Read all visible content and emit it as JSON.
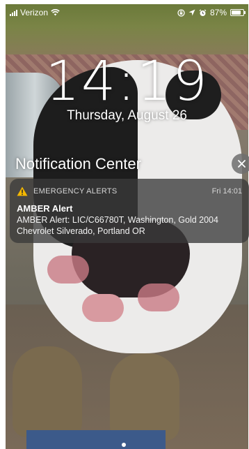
{
  "status_bar": {
    "carrier": "Verizon",
    "battery_percent": "87%"
  },
  "lock_screen": {
    "time": "14:19",
    "date": "Thursday, August 26"
  },
  "notification_center": {
    "title": "Notification Center"
  },
  "notification": {
    "app_name": "EMERGENCY ALERTS",
    "timestamp": "Fri 14:01",
    "title": "AMBER Alert",
    "body": "AMBER Alert: LIC/C66780T, Washington, Gold 2004 Chevrolet Silverado, Portland OR"
  },
  "colors": {
    "warning_icon": "#f5b800",
    "card_bg": "#3a3a3a"
  },
  "icons": [
    "signal-bars-icon",
    "wifi-icon",
    "orientation-lock-icon",
    "location-icon",
    "alarm-icon",
    "battery-icon",
    "warning-icon",
    "close-icon"
  ]
}
